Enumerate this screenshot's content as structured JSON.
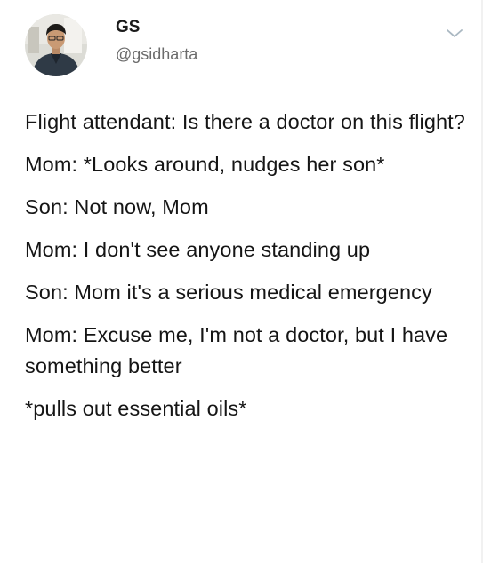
{
  "author": {
    "display_name": "GS",
    "handle": "@gsidharta",
    "avatar_icon": "user-avatar-photo"
  },
  "menu": {
    "icon": "chevron-down-icon"
  },
  "tweet": {
    "lines": [
      "Flight attendant: Is there a doctor on this flight?",
      "Mom: *Looks around, nudges her son*",
      "Son: Not now, Mom",
      "Mom: I don't see anyone standing up",
      "Son: Mom it's a serious medical emergency",
      "Mom:  Excuse me, I'm not a doctor, but I have something better",
      "*pulls out essential oils*"
    ]
  },
  "colors": {
    "text": "#151515",
    "handle": "#6b6b6b",
    "chevron": "#aab8c2"
  }
}
